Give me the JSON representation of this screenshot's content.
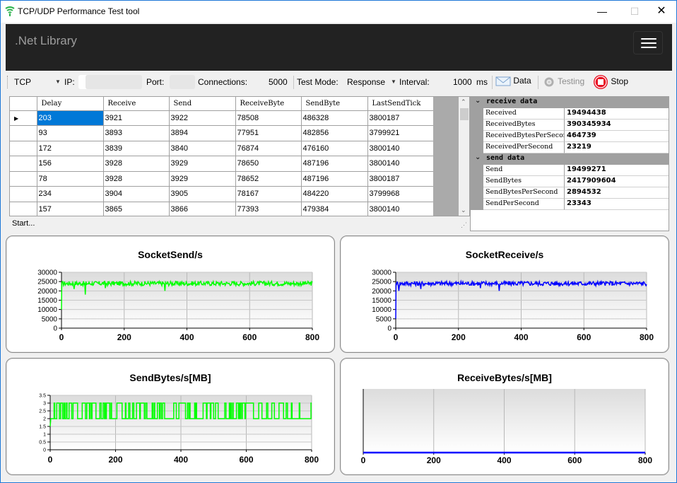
{
  "window": {
    "title": "TCP/UDP Performance Test tool",
    "minimize_glyph": "—",
    "maximize_glyph": "☐",
    "close_glyph": "✕"
  },
  "navbar": {
    "brand": ".Net Library"
  },
  "toolbar": {
    "protocol": "TCP",
    "ip_label": "IP:",
    "port_label": "Port:",
    "connections_label": "Connections:",
    "connections_value": "5000",
    "test_mode_label": "Test Mode:",
    "test_mode_value": "Response",
    "interval_label": "Interval:",
    "interval_value": "1000",
    "interval_unit": "ms",
    "data_label": "Data",
    "testing_label": "Testing",
    "stop_label": "Stop"
  },
  "grid": {
    "columns": [
      "Delay",
      "Receive",
      "Send",
      "ReceiveByte",
      "SendByte",
      "LastSendTick"
    ],
    "rows": [
      [
        "203",
        "3921",
        "3922",
        "78508",
        "486328",
        "3800187"
      ],
      [
        "93",
        "3893",
        "3894",
        "77951",
        "482856",
        "3799921"
      ],
      [
        "172",
        "3839",
        "3840",
        "76874",
        "476160",
        "3800140"
      ],
      [
        "156",
        "3928",
        "3929",
        "78650",
        "487196",
        "3800140"
      ],
      [
        "78",
        "3928",
        "3929",
        "78652",
        "487196",
        "3800187"
      ],
      [
        "234",
        "3904",
        "3905",
        "78167",
        "484220",
        "3799968"
      ],
      [
        "157",
        "3865",
        "3866",
        "77393",
        "479384",
        "3800140"
      ]
    ]
  },
  "status": {
    "text": "Start..."
  },
  "properties": {
    "receive": {
      "title": "receive data",
      "items": [
        {
          "key": "Received",
          "value": "19494438"
        },
        {
          "key": "ReceivedBytes",
          "value": "390345934"
        },
        {
          "key": "ReceivedBytesPerSecond",
          "value": "464739"
        },
        {
          "key": "ReceivedPerSecond",
          "value": "23219"
        }
      ]
    },
    "send": {
      "title": "send data",
      "items": [
        {
          "key": "Send",
          "value": "19499271"
        },
        {
          "key": "SendBytes",
          "value": "2417909604"
        },
        {
          "key": "SendBytesPerSecond",
          "value": "2894532"
        },
        {
          "key": "SendPerSecond",
          "value": "23343"
        }
      ]
    }
  },
  "chart_data": [
    {
      "type": "line",
      "title": "SocketSend/s",
      "xlim": [
        0,
        800
      ],
      "ylim": [
        0,
        30000
      ],
      "xticks": [
        0,
        200,
        400,
        600,
        800
      ],
      "yticks": [
        0,
        5000,
        10000,
        15000,
        20000,
        25000,
        30000
      ],
      "series": [
        {
          "color": "#00ff00",
          "base": 24000,
          "noise": 1200,
          "start": [
            0,
            10000
          ],
          "dips": [
            [
              40,
              21000
            ],
            [
              76,
              18000
            ],
            [
              330,
              20000
            ],
            [
              140,
              21500
            ]
          ]
        }
      ]
    },
    {
      "type": "line",
      "title": "SocketReceive/s",
      "xlim": [
        0,
        800
      ],
      "ylim": [
        0,
        30000
      ],
      "xticks": [
        0,
        200,
        400,
        600,
        800
      ],
      "yticks": [
        0,
        5000,
        10000,
        15000,
        20000,
        25000,
        30000
      ],
      "series": [
        {
          "color": "#0000ff",
          "base": 24000,
          "noise": 1200,
          "start": [
            0,
            5000
          ],
          "dips": [
            [
              10,
              20000
            ],
            [
              80,
              21000
            ],
            [
              270,
              21500
            ],
            [
              330,
              20000
            ]
          ]
        }
      ]
    },
    {
      "type": "line",
      "title": "SendBytes/s[MB]",
      "xlim": [
        0,
        800
      ],
      "ylim": [
        0,
        3.5
      ],
      "xticks": [
        0,
        200,
        400,
        600,
        800
      ],
      "yticks": [
        0,
        0.5,
        1,
        1.5,
        2,
        2.5,
        3,
        3.5
      ],
      "series": [
        {
          "color": "#00ff00",
          "levels": [
            2,
            3
          ],
          "start": [
            0,
            1.5
          ]
        }
      ]
    },
    {
      "type": "line",
      "title": "ReceiveBytes/s[MB]",
      "xlim": [
        0,
        800
      ],
      "ylim": [
        0,
        1
      ],
      "xticks": [
        0,
        200,
        400,
        600,
        800
      ],
      "yticks": [],
      "series": [
        {
          "color": "#0000ff",
          "constant": 0
        }
      ]
    }
  ],
  "colors": {
    "selection": "#0078d7",
    "navbar": "#222222",
    "stop_red": "#e81123"
  }
}
